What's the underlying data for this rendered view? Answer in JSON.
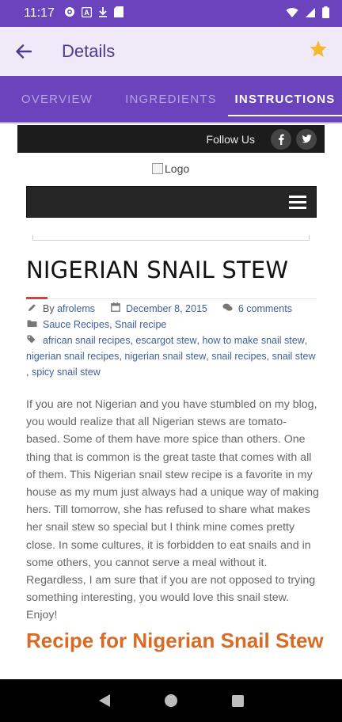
{
  "status_bar": {
    "time": "11:17",
    "icons": [
      "gear-icon",
      "a-box-icon",
      "download-icon",
      "sd-card-icon"
    ],
    "right_icons": [
      "wifi-icon",
      "signal-icon",
      "battery-icon"
    ]
  },
  "app_bar": {
    "title": "Details",
    "back_icon": "arrow-left-icon",
    "favorite_icon": "star-icon",
    "favorite_color": "#f5b82e"
  },
  "tabs": [
    {
      "label": "OVERVIEW",
      "active": false
    },
    {
      "label": "INGREDIENTS",
      "active": false
    },
    {
      "label": "INSTRUCTIONS",
      "active": true
    }
  ],
  "colors": {
    "primary": "#6a43bd",
    "app_bar_bg": "#efe9f8",
    "title_accent": "#d9403b",
    "heading_orange": "#d96b24",
    "link_blue": "#3d5f9c"
  },
  "webview": {
    "follow_us": "Follow Us",
    "social": [
      {
        "name": "facebook",
        "glyph": "f"
      },
      {
        "name": "twitter",
        "glyph": "t"
      }
    ],
    "logo_alt": "Logo",
    "post_title": "NIGERIAN SNAIL STEW",
    "meta": {
      "author_prefix": "By",
      "author": "afrolems",
      "date": "December 8, 2015",
      "comments": "6 comments",
      "categories": [
        "Sauce Recipes",
        "Snail recipe"
      ],
      "tags": [
        "african snail recipes",
        "escargot stew",
        "how to make snail stew",
        "nigerian snail recipes",
        "nigerian snail stew",
        "snail recipes",
        "snail stew",
        "spicy snail stew"
      ]
    },
    "body": "If you are not Nigerian and you have stumbled on my blog, you would realize that all Nigerian stews are tomato-based. Some of them have more spice than others. One thing that is common is the great taste that comes with all of them. This Nigerian snail stew recipe is a favorite in my house as my mum just always had a unique way of making hers. Till tomorrow, she has refused to share what makes her snail stew so special but I think mine comes pretty close. In some cultures, it is forbidden to eat snails and in some others, you cannot serve a meal without it. Regardless, I am sure that if you are not opposed to trying something interesting, you would love this snail stew. Enjoy!",
    "section_heading": "Recipe for Nigerian Snail Stew"
  },
  "nav_bar": {
    "buttons": [
      "back-triangle-icon",
      "home-circle-icon",
      "recents-square-icon"
    ]
  }
}
